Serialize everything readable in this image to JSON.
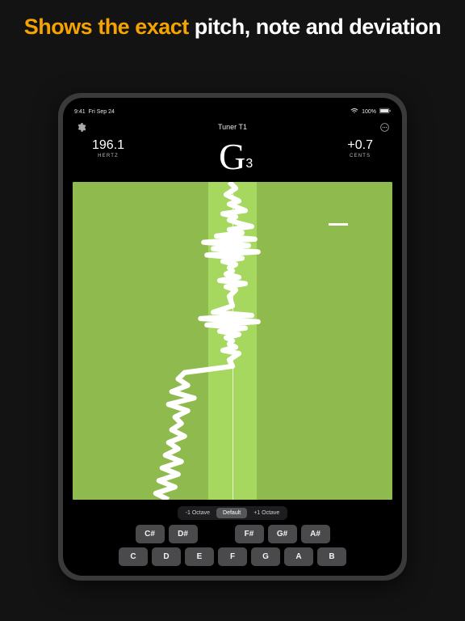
{
  "promo": {
    "highlight": "Shows the exact",
    "rest": " pitch, note and deviation"
  },
  "statusbar": {
    "time": "9:41",
    "date": "Fri Sep 24",
    "battery": "100%"
  },
  "titlebar": {
    "title": "Tuner T1"
  },
  "readout": {
    "hertz": {
      "value": "196.1",
      "label": "HERTZ"
    },
    "note": {
      "letter": "G",
      "octave": "3"
    },
    "cents": {
      "value": "+0.7",
      "label": "CENTS"
    }
  },
  "viz": {
    "background": "#8fbb4e",
    "band": "#a6d85f"
  },
  "octave_segment": {
    "options": [
      "-1 Octave",
      "Default",
      "+1 Octave"
    ],
    "selected": 1
  },
  "keys": {
    "sharps": [
      "C#",
      "D#",
      null,
      "F#",
      "G#",
      "A#"
    ],
    "naturals": [
      "C",
      "D",
      "E",
      "F",
      "G",
      "A",
      "B"
    ]
  }
}
